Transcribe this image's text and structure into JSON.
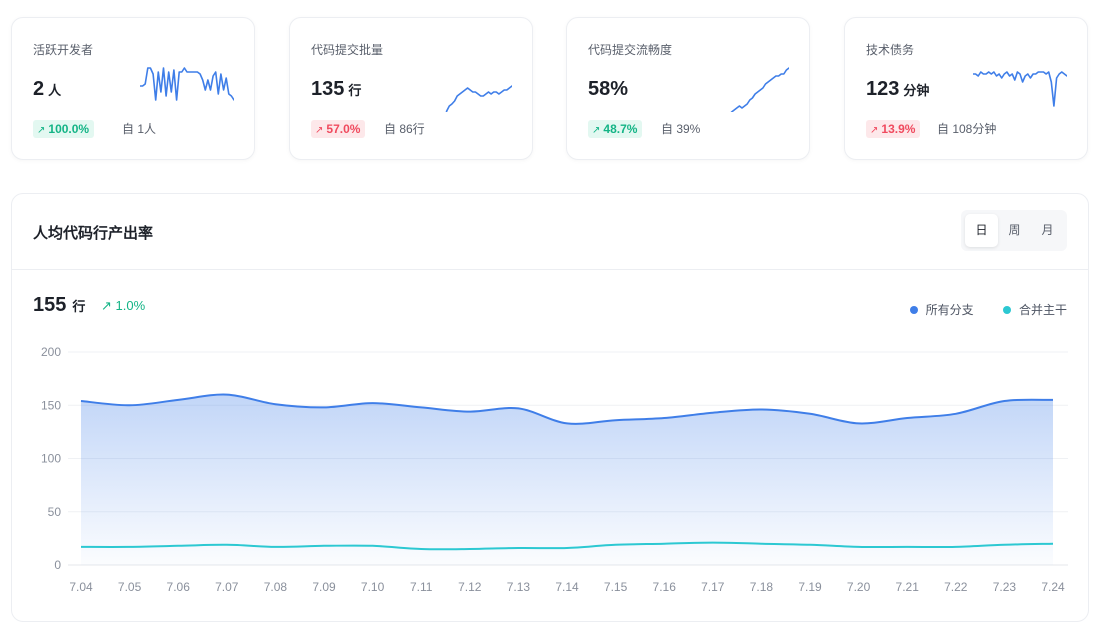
{
  "cards": [
    {
      "title": "活跃开发者",
      "value": "2",
      "unit": "人",
      "change": "100.0%",
      "direction": "up",
      "from": "自 1人",
      "sparkline": [
        20,
        20,
        18,
        2,
        2,
        8,
        34,
        6,
        26,
        2,
        30,
        6,
        26,
        4,
        34,
        6,
        6,
        2,
        6,
        6,
        6,
        6,
        6,
        8,
        14,
        24,
        14,
        24,
        10,
        6,
        28,
        8,
        24,
        12,
        28,
        30,
        34
      ]
    },
    {
      "title": "代码提交批量",
      "value": "135",
      "unit": "行",
      "change": "57.0%",
      "direction": "down",
      "from": "自 86行",
      "sparkline": [
        85,
        110,
        118,
        118,
        112,
        98,
        72,
        70,
        66,
        62,
        55,
        45,
        40,
        38,
        35,
        30,
        28,
        26,
        24,
        22,
        24,
        26,
        26,
        28,
        30,
        30,
        28,
        26,
        28,
        26,
        26,
        28,
        26,
        24,
        24,
        22,
        20
      ]
    },
    {
      "title": "代码提交流畅度",
      "value": "58%",
      "unit": "",
      "change": "48.7%",
      "direction": "up",
      "from": "自 39%",
      "sparkline": [
        60,
        62,
        60,
        58,
        56,
        56,
        54,
        52,
        54,
        52,
        50,
        48,
        48,
        50,
        46,
        44,
        42,
        40,
        42,
        40,
        38,
        34,
        32,
        28,
        26,
        24,
        22,
        18,
        16,
        14,
        12,
        10,
        10,
        8,
        8,
        4,
        2
      ]
    },
    {
      "title": "技术债务",
      "value": "123",
      "unit": "分钟",
      "change": "13.9%",
      "direction": "down",
      "from": "自 108分钟",
      "sparkline": [
        8,
        8,
        10,
        6,
        8,
        8,
        6,
        8,
        6,
        10,
        8,
        12,
        8,
        6,
        10,
        8,
        14,
        6,
        8,
        16,
        10,
        8,
        12,
        8,
        8,
        6,
        6,
        6,
        8,
        6,
        16,
        40,
        12,
        8,
        6,
        8,
        10
      ]
    }
  ],
  "panel": {
    "title": "人均代码行产出率",
    "tabs": [
      {
        "label": "日",
        "active": true
      },
      {
        "label": "周",
        "active": false
      },
      {
        "label": "月",
        "active": false
      }
    ],
    "summary_value": "155",
    "summary_unit": "行",
    "summary_change": "1.0%",
    "legend": [
      {
        "label": "所有分支",
        "color": "#3f7ee8"
      },
      {
        "label": "合并主干",
        "color": "#2cc8d2"
      }
    ]
  },
  "colors": {
    "up": "#14b486",
    "down": "#f04a5e",
    "accent": "#3f7ee8",
    "teal": "#2cc8d2"
  },
  "chart_data": {
    "type": "area",
    "title": "人均代码行产出率",
    "xlabel": "",
    "ylabel": "",
    "categories": [
      "7.04",
      "7.05",
      "7.06",
      "7.07",
      "7.08",
      "7.09",
      "7.10",
      "7.11",
      "7.12",
      "7.13",
      "7.14",
      "7.15",
      "7.16",
      "7.17",
      "7.18",
      "7.19",
      "7.20",
      "7.21",
      "7.22",
      "7.23",
      "7.24"
    ],
    "ylim": [
      0,
      200
    ],
    "yticks": [
      0,
      50,
      100,
      150,
      200
    ],
    "grid": true,
    "legend_position": "top-right",
    "series": [
      {
        "name": "所有分支",
        "color": "#3f7ee8",
        "fill": true,
        "values": [
          154,
          150,
          155,
          160,
          151,
          148,
          152,
          148,
          144,
          147,
          133,
          136,
          138,
          143,
          146,
          142,
          133,
          138,
          142,
          154,
          155
        ]
      },
      {
        "name": "合并主干",
        "color": "#2cc8d2",
        "fill": false,
        "values": [
          17,
          17,
          18,
          19,
          17,
          18,
          18,
          15,
          15,
          16,
          16,
          19,
          20,
          21,
          20,
          19,
          17,
          17,
          17,
          19,
          20
        ]
      }
    ]
  }
}
